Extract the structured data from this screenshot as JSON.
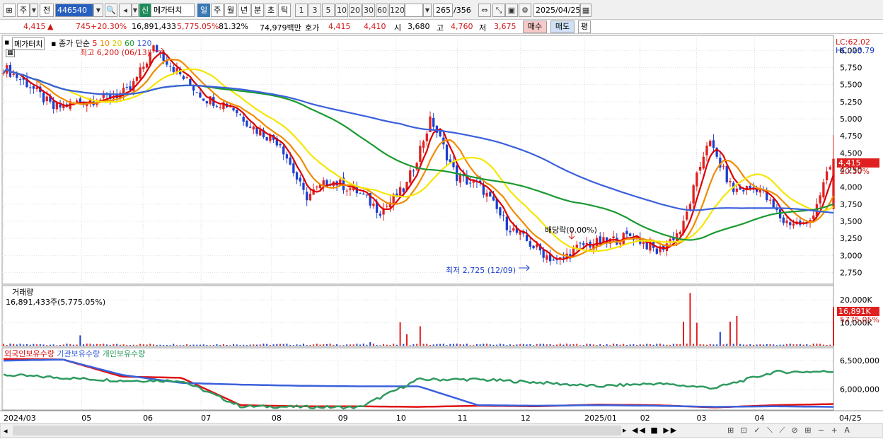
{
  "toolbar": {
    "period_select": "주",
    "prev_label": "전",
    "code": "446540",
    "new_badge": "신",
    "name": "메가터치",
    "periods": [
      "일",
      "주",
      "월",
      "년",
      "분",
      "초",
      "틱"
    ],
    "active_period": "일",
    "intervals": [
      "1",
      "3",
      "5",
      "10",
      "20",
      "30",
      "60",
      "120"
    ],
    "count": "265",
    "total": "/356",
    "date": "2025/04/25"
  },
  "quote": {
    "price": "4,415",
    "arrow": "▲",
    "change": "745",
    "change_pct": "+20.30%",
    "volume": "16,891,433",
    "volume_ratio": "5,775.05%",
    "turnover": "81.32%",
    "amount": "74,979백만",
    "bid_label": "호가",
    "ask": "4,415",
    "bid": "4,410",
    "open_label": "시",
    "open": "3,680",
    "high_label": "고",
    "high": "4,760",
    "low_label": "저",
    "low": "3,675",
    "buy_button": "매수",
    "sell_button": "매도",
    "eval_button": "평"
  },
  "price_panel": {
    "title": "메가터치",
    "ma_label": "종가 단순",
    "ma_periods": [
      "5",
      "10",
      "20",
      "60",
      "120"
    ],
    "high_note": "최고 6,200 (06/13)",
    "low_note": "최저 2,725 (12/09)",
    "dividend_note": "배당락(0.00%)",
    "lc": "LC:62.02",
    "hc": "HC:-28.79",
    "last_price_tag": "4,415",
    "last_pct_tag": "20.30%",
    "y_ticks": [
      "6,000",
      "5,750",
      "5,500",
      "5,250",
      "5,000",
      "4,750",
      "4,500",
      "4,250",
      "4,000",
      "3,750",
      "3,500",
      "3,250",
      "3,000",
      "2,750"
    ]
  },
  "volume_panel": {
    "title": "거래량",
    "value": "16,891,433주(5,775.05%)",
    "y_ticks": [
      "20,000K",
      "10,000K"
    ],
    "last_tag": "16,891K",
    "last_pct": "5775.05%"
  },
  "holdings_panel": {
    "legends": [
      "외국인보유수량",
      "기관보유수량",
      "개인보유수량"
    ],
    "y_ticks": [
      "6,500,000",
      "6,000,000"
    ]
  },
  "x_ticks": [
    "2024/03",
    "05",
    "06",
    "07",
    "08",
    "09",
    "10",
    "11",
    "12",
    "2025/01",
    "02",
    "03",
    "04",
    "04/25"
  ],
  "colors": {
    "up": "#e02020",
    "down": "#1c3fd0",
    "ma5": "#dd0000",
    "ma10": "#f08c00",
    "ma20": "#f5e600",
    "ma60": "#1a9a30",
    "ma120": "#3a60dc",
    "foreign": "#e01010",
    "inst": "#3a60dc",
    "indiv": "#2e9a60"
  },
  "chart_data": [
    {
      "type": "candlestick",
      "title": "메가터치",
      "series": [
        {
          "name": "메가터치",
          "role": "ohlc"
        },
        {
          "name": "5"
        },
        {
          "name": "10"
        },
        {
          "name": "20"
        },
        {
          "name": "60"
        },
        {
          "name": "120"
        }
      ],
      "x": [
        "2024/03",
        "05",
        "06",
        "07",
        "08",
        "09",
        "10",
        "11",
        "12",
        "2025/01",
        "02",
        "03",
        "04"
      ],
      "close_path": [
        5750,
        5500,
        5150,
        5250,
        5300,
        5400,
        6050,
        5650,
        5300,
        5200,
        4850,
        4650,
        3850,
        4100,
        3950,
        3650,
        4000,
        5000,
        4150,
        4000,
        3450,
        3150,
        2900,
        3150,
        3200,
        3300,
        3050,
        3400,
        4700,
        3950,
        4000,
        3500,
        3450,
        4415
      ],
      "ylim": [
        2600,
        6200
      ],
      "high": {
        "value": 6200,
        "date": "06/13"
      },
      "low": {
        "value": 2725,
        "date": "12/09"
      }
    },
    {
      "type": "bar",
      "title": "거래량",
      "last_value": 16891433,
      "ylim": [
        0,
        25000000
      ]
    },
    {
      "type": "line",
      "series": [
        {
          "name": "외국인보유수량",
          "values": [
            6530000,
            6520000,
            6220000,
            6200000,
            5720000,
            5700000,
            5700000,
            5690000,
            5710000,
            5700000,
            5730000,
            5720000,
            5680000,
            5720000,
            5740000
          ]
        },
        {
          "name": "기관보유수량",
          "values": [
            6500000,
            6520000,
            6250000,
            6110000,
            6080000,
            6060000,
            6050000,
            6050000,
            5720000,
            5710000,
            5720000,
            5710000,
            5690000,
            5700000,
            5690000
          ]
        },
        {
          "name": "개인보유수량",
          "values": [
            6250000,
            6200000,
            6150000,
            6150000,
            5700000,
            5690000,
            5680000,
            6170000,
            6170000,
            6120000,
            6050000,
            6100000,
            6020000,
            6300000,
            6310000
          ]
        }
      ]
    }
  ]
}
